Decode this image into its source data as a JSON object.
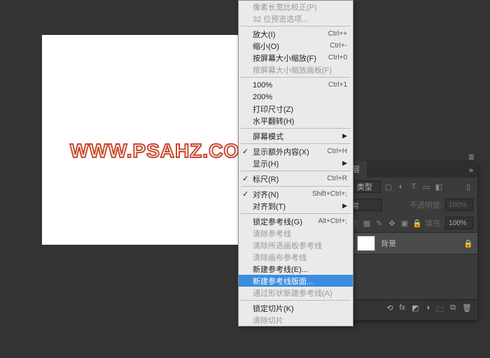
{
  "watermark": "WWW.PSAHZ.COM",
  "menu": {
    "items": [
      {
        "label": "像素长宽比校正(P)",
        "disabled": true
      },
      {
        "label": "32 位预览选项...",
        "disabled": true
      },
      {
        "sep": true
      },
      {
        "label": "放大(I)",
        "sc": "Ctrl++"
      },
      {
        "label": "缩小(O)",
        "sc": "Ctrl+-"
      },
      {
        "label": "按屏幕大小缩放(F)",
        "sc": "Ctrl+0"
      },
      {
        "label": "按屏幕大小缩放画板(F)",
        "disabled": true
      },
      {
        "sep": true
      },
      {
        "label": "100%",
        "sc": "Ctrl+1"
      },
      {
        "label": "200%"
      },
      {
        "label": "打印尺寸(Z)"
      },
      {
        "label": "水平翻转(H)"
      },
      {
        "sep": true
      },
      {
        "label": "屏幕模式",
        "arrow": true
      },
      {
        "sep": true
      },
      {
        "label": "显示额外内容(X)",
        "chk": true,
        "sc": "Ctrl+H"
      },
      {
        "label": "显示(H)",
        "arrow": true
      },
      {
        "sep": true
      },
      {
        "label": "标尺(R)",
        "chk": true,
        "sc": "Ctrl+R"
      },
      {
        "sep": true
      },
      {
        "label": "对齐(N)",
        "chk": true,
        "sc": "Shift+Ctrl+;"
      },
      {
        "label": "对齐到(T)",
        "arrow": true
      },
      {
        "sep": true
      },
      {
        "label": "锁定参考线(G)",
        "sc": "Alt+Ctrl+;"
      },
      {
        "label": "清除参考线",
        "disabled": true
      },
      {
        "label": "清除所选画板参考线",
        "disabled": true
      },
      {
        "label": "清除画布参考线",
        "disabled": true
      },
      {
        "label": "新建参考线(E)..."
      },
      {
        "label": "新建参考线版面...",
        "sel": true
      },
      {
        "label": "通过形状新建参考线(A)",
        "disabled": true
      },
      {
        "sep": true
      },
      {
        "label": "锁定切片(K)"
      },
      {
        "label": "清除切片",
        "disabled": true
      }
    ]
  },
  "panel": {
    "tab": "图层",
    "typePlaceholder": "类型",
    "blend": "正常",
    "opacityLabel": "不透明度:",
    "opacityVal": "100%",
    "lockLabel": "锁定:",
    "fillLabel": "填充:",
    "fillVal": "100%",
    "layerName": "背景"
  }
}
